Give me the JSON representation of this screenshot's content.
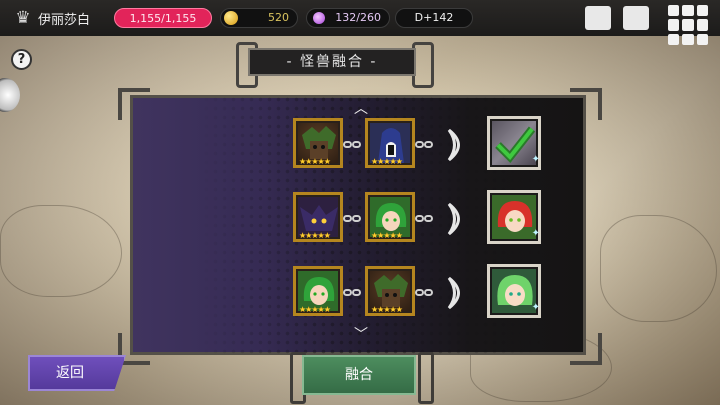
{
  "player": {
    "name": "伊丽莎白",
    "icon": "crown-icon"
  },
  "stats": {
    "hp": "1,155/1,155",
    "gold": "520",
    "mana": "132/260",
    "day": "D+142"
  },
  "title": "- 怪兽融合 -",
  "help": "?",
  "fusions": [
    {
      "left": {
        "name": "treant",
        "stars": "★★★★★"
      },
      "right": {
        "name": "hooded-ghost",
        "stars": "★★★★★"
      },
      "result": {
        "name": "unknown-demon",
        "sparkle": "✦",
        "known": true
      }
    },
    {
      "left": {
        "name": "shadow-bat",
        "stars": "★★★★★"
      },
      "right": {
        "name": "green-dryad",
        "stars": "★★★★★"
      },
      "result": {
        "name": "red-fairy",
        "sparkle": "✦"
      }
    },
    {
      "left": {
        "name": "green-dryad",
        "stars": "★★★★★"
      },
      "right": {
        "name": "treant",
        "stars": "★★★★★"
      },
      "result": {
        "name": "green-fairy",
        "sparkle": "✦"
      }
    }
  ],
  "buttons": {
    "back": "返回",
    "fuse": "融合"
  },
  "colors": {
    "hp": "#e2245a",
    "back": "#6f4fbc",
    "fuse": "#4d8d5e",
    "frame": "#b5861f"
  }
}
